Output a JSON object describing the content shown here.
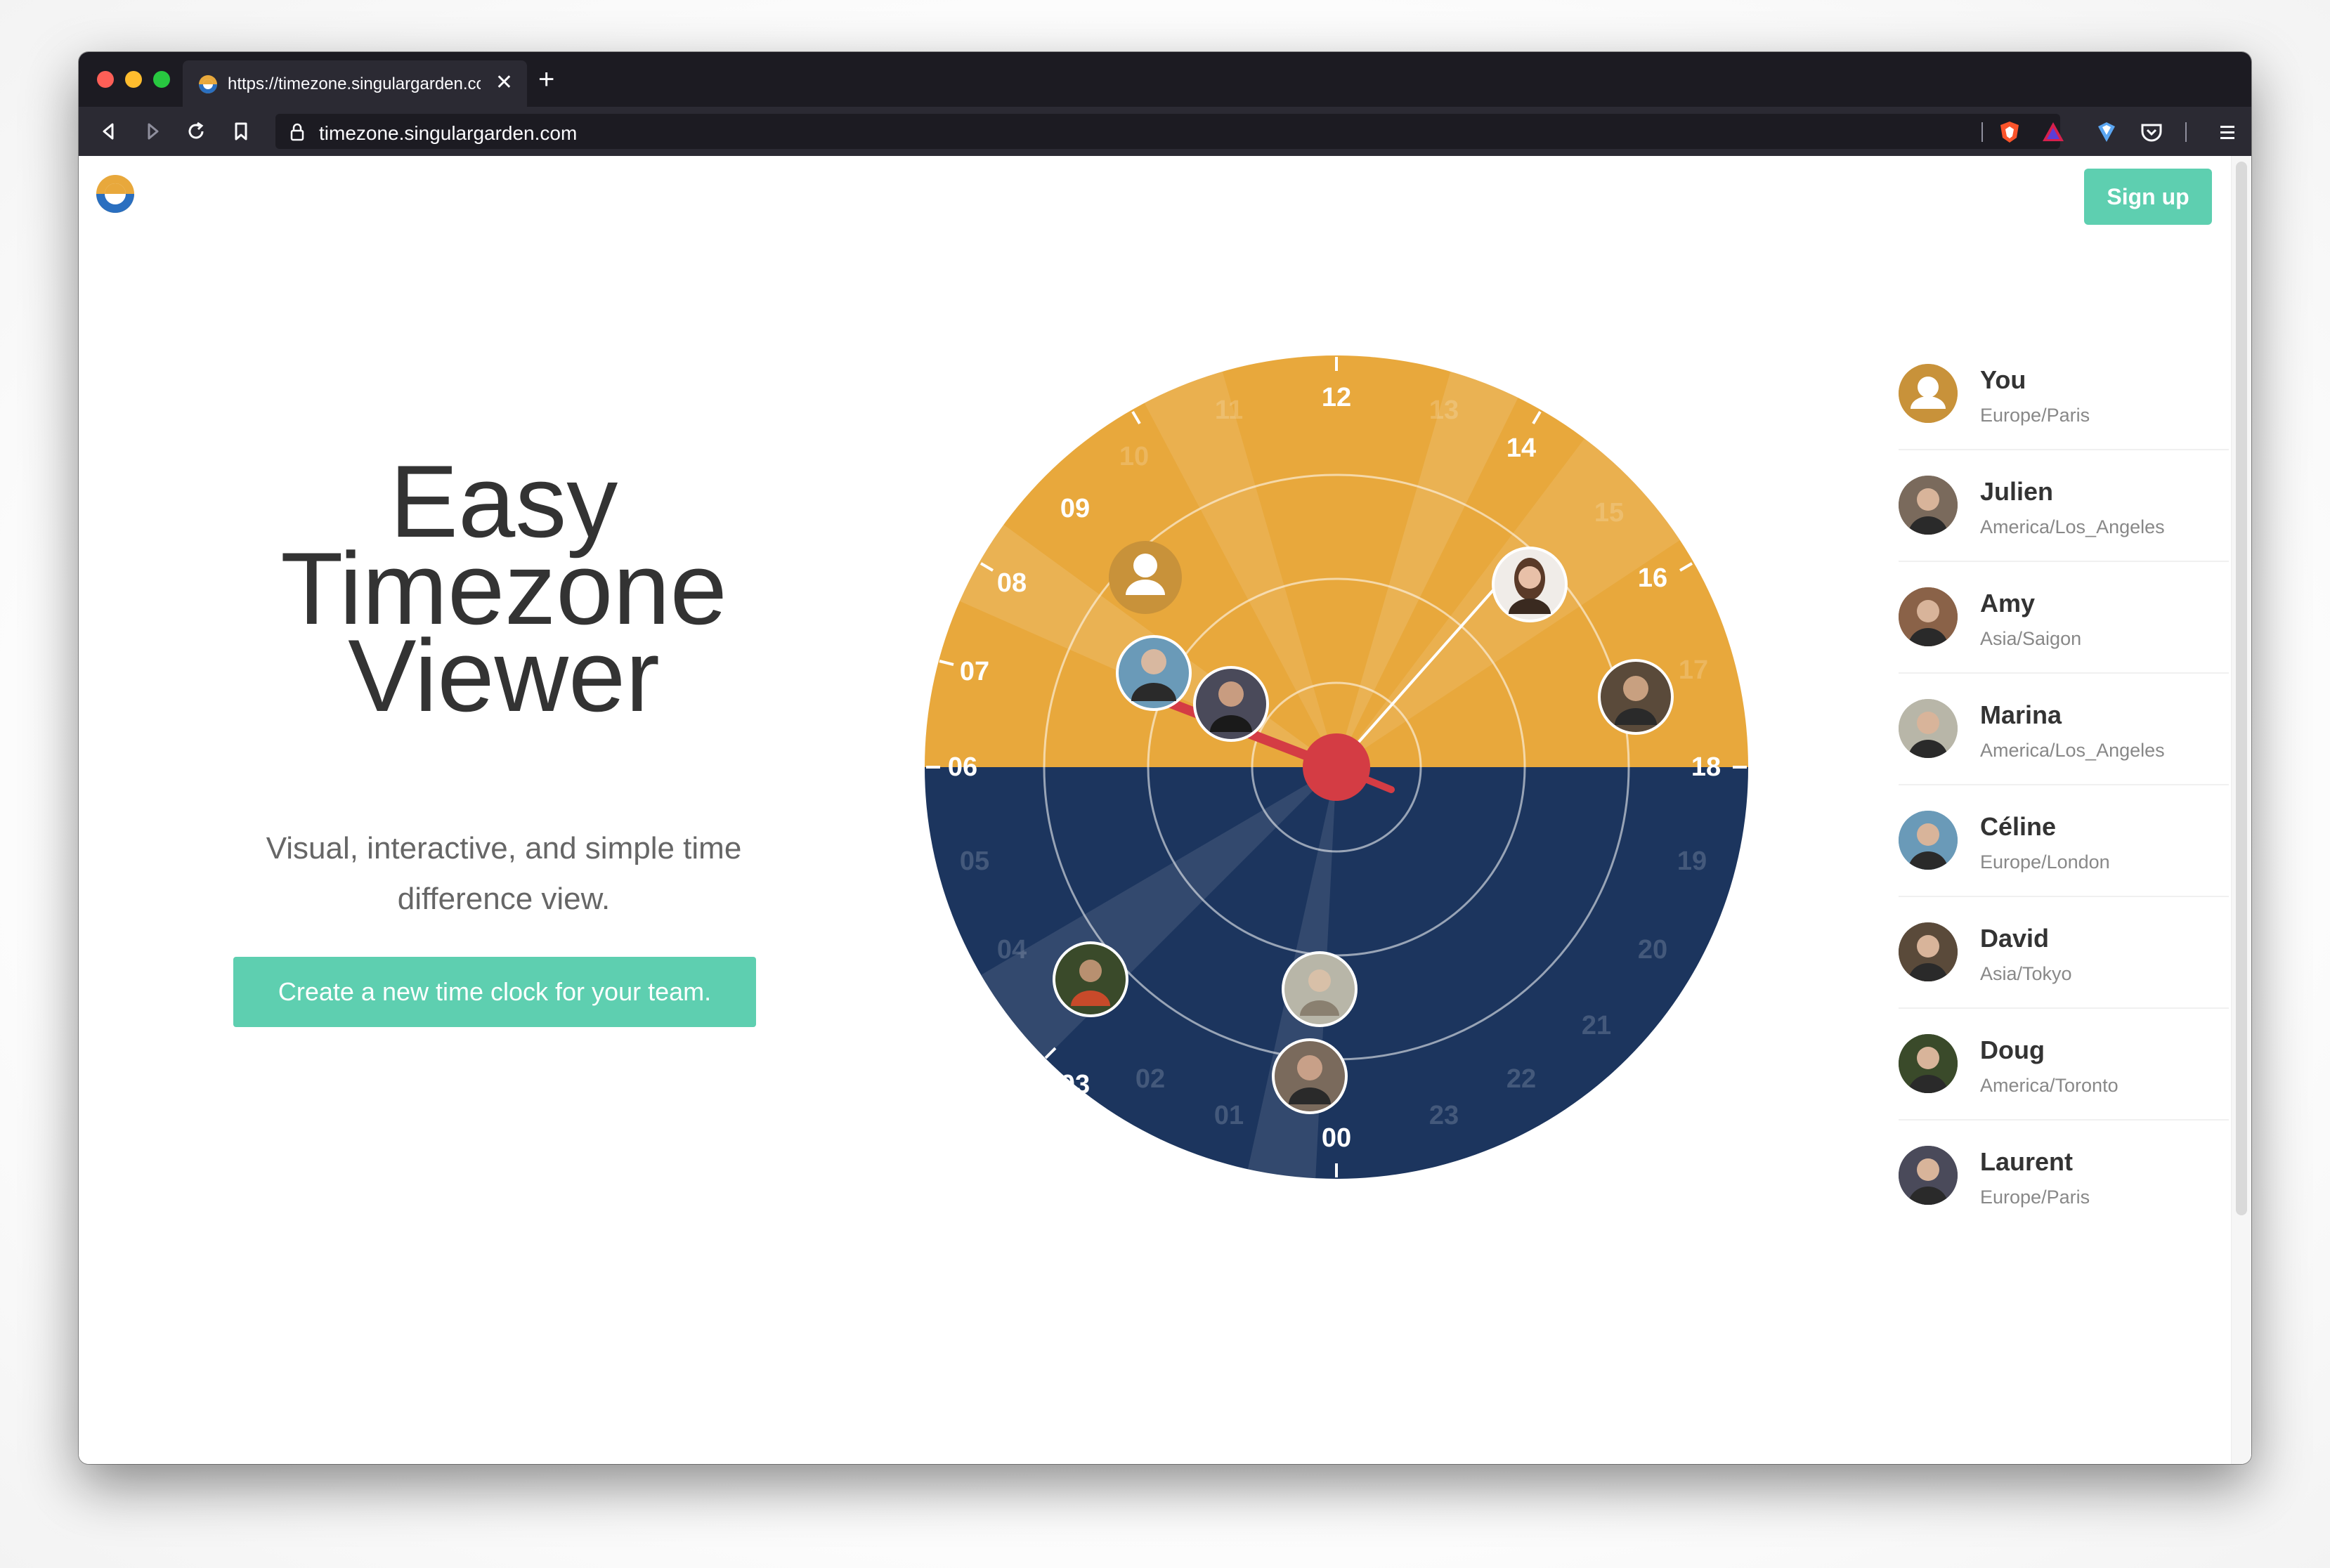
{
  "browser": {
    "tab_title": "https://timezone.singulargarden.com",
    "tab_close": "✕",
    "new_tab": "+",
    "url": "timezone.singulargarden.com"
  },
  "header": {
    "signup_label": "Sign up"
  },
  "hero": {
    "title_line1": "Easy",
    "title_line2": "Timezone",
    "title_line3": "Viewer",
    "subtitle": "Visual, interactive, and simple time difference view.",
    "cta_label": "Create a new time clock for your team."
  },
  "clock": {
    "colors": {
      "day": "#e8a83c",
      "night": "#1c355e",
      "hand": "#d43c44",
      "accent": "#5ecfb0"
    },
    "hours_bright": [
      "12",
      "14",
      "16",
      "18",
      "00",
      "03",
      "06",
      "07",
      "08",
      "09"
    ],
    "hours_faded": [
      "11",
      "13",
      "10",
      "15",
      "17",
      "19",
      "20",
      "21",
      "22",
      "23",
      "01",
      "02",
      "04",
      "05"
    ]
  },
  "team": [
    {
      "name": "You",
      "tz": "Europe/Paris",
      "avatar": "user-placeholder-icon",
      "color": "#c8923a"
    },
    {
      "name": "Julien",
      "tz": "America/Los_Angeles",
      "avatar": "photo",
      "color": "#7a6a5c"
    },
    {
      "name": "Amy",
      "tz": "Asia/Saigon",
      "avatar": "photo",
      "color": "#8a6248"
    },
    {
      "name": "Marina",
      "tz": "America/Los_Angeles",
      "avatar": "photo",
      "color": "#b8b6a8"
    },
    {
      "name": "Céline",
      "tz": "Europe/London",
      "avatar": "photo",
      "color": "#6a9ab8"
    },
    {
      "name": "David",
      "tz": "Asia/Tokyo",
      "avatar": "photo",
      "color": "#5a4a3a"
    },
    {
      "name": "Doug",
      "tz": "America/Toronto",
      "avatar": "photo",
      "color": "#3a4a2a"
    },
    {
      "name": "Laurent",
      "tz": "Europe/Paris",
      "avatar": "photo",
      "color": "#4a4a5a"
    }
  ]
}
